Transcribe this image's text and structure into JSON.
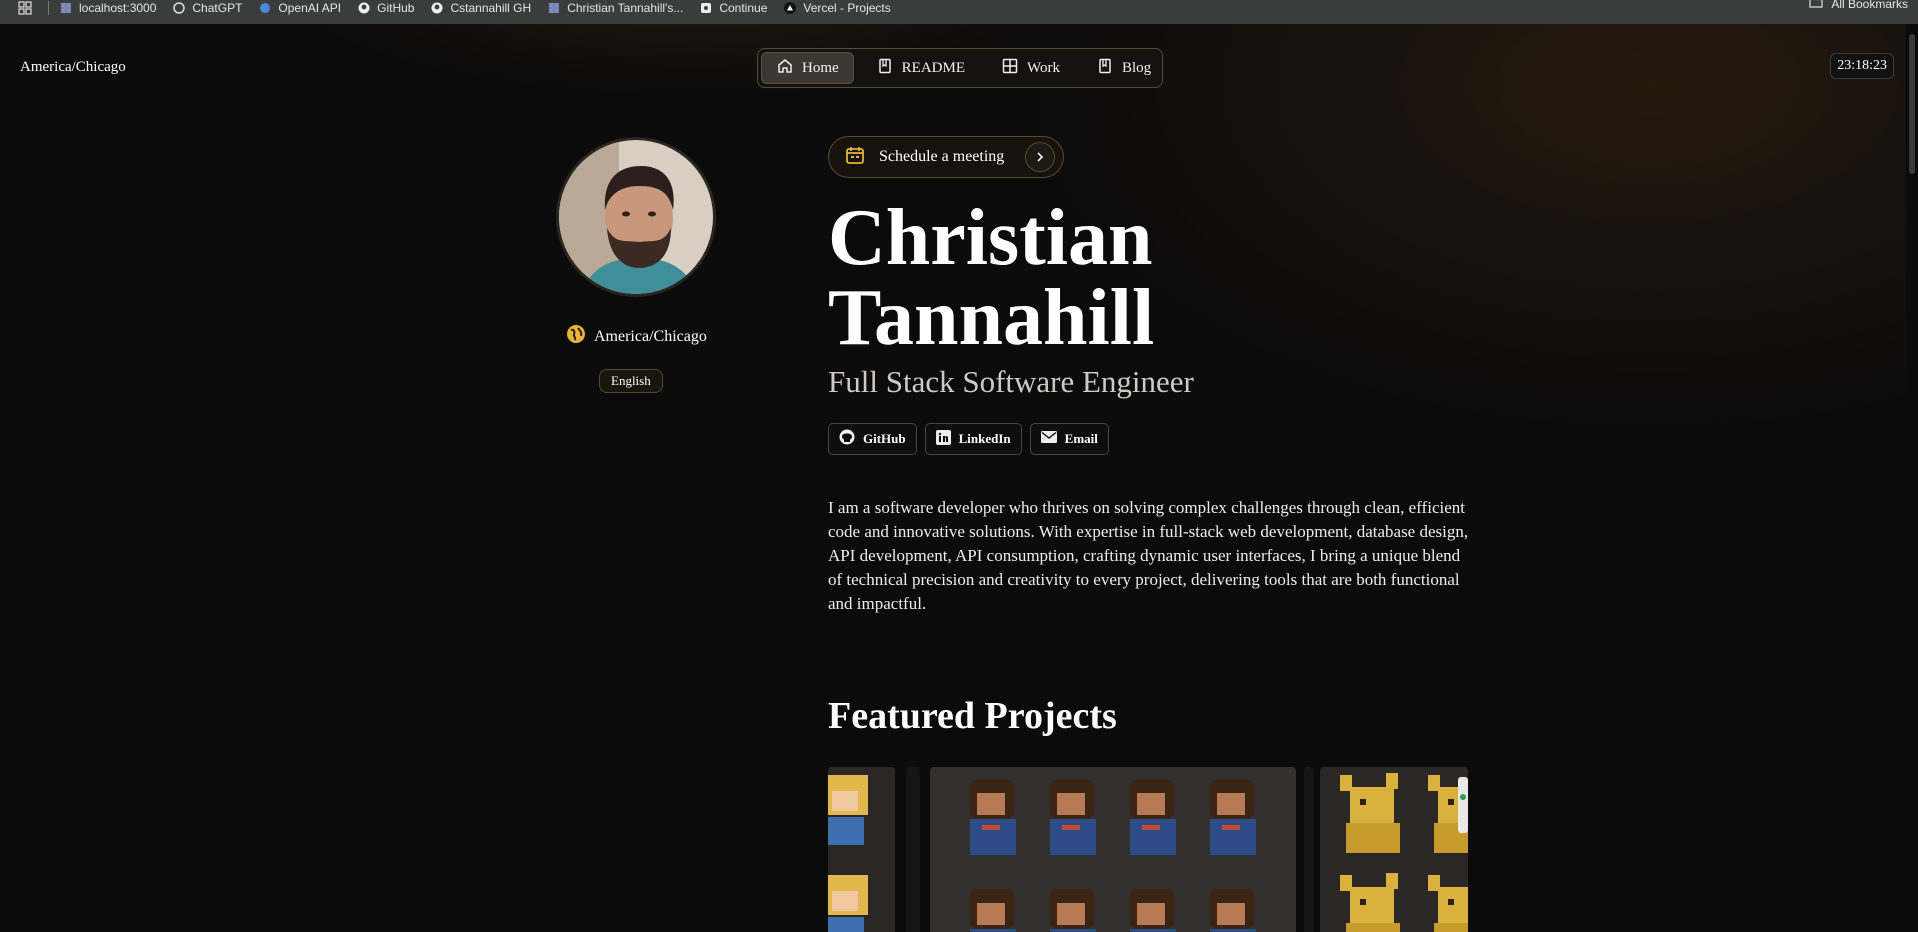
{
  "bookmarks": {
    "items": [
      {
        "label": "localhost:3000",
        "icon": "page-icon"
      },
      {
        "label": "ChatGPT",
        "icon": "openai-icon"
      },
      {
        "label": "OpenAI API",
        "icon": "openai-icon"
      },
      {
        "label": "GitHub",
        "icon": "github-icon"
      },
      {
        "label": "Cstannahill GH",
        "icon": "github-icon"
      },
      {
        "label": "Christian Tannahill's...",
        "icon": "page-icon"
      },
      {
        "label": "Continue",
        "icon": "continue-icon"
      },
      {
        "label": "Vercel - Projects",
        "icon": "vercel-icon"
      }
    ],
    "all_label": "All Bookmarks"
  },
  "header": {
    "timezone": "America/Chicago",
    "clock": "23:18:23",
    "nav": [
      {
        "label": "Home",
        "icon": "home-icon",
        "active": true
      },
      {
        "label": "README",
        "icon": "book-icon"
      },
      {
        "label": "Work",
        "icon": "grid-icon"
      },
      {
        "label": "Blog",
        "icon": "book-icon"
      }
    ]
  },
  "profile": {
    "location": "America/Chicago",
    "language": "English"
  },
  "hero": {
    "schedule_label": "Schedule a meeting",
    "name_line1": "Christian",
    "name_line2": "Tannahill",
    "role": "Full Stack Software Engineer",
    "socials": [
      {
        "label": "GitHub",
        "icon": "github-icon"
      },
      {
        "label": "LinkedIn",
        "icon": "linkedin-icon"
      },
      {
        "label": "Email",
        "icon": "email-icon"
      }
    ],
    "bio": "I am a software developer who thrives on solving complex challenges through clean, efficient code and innovative solutions. With expertise in full-stack web development, database design, API development, API consumption, crafting dynamic user interfaces, I bring a unique blend of technical precision and creativity to every project, delivering tools that are both functional and impactful."
  },
  "featured": {
    "title": "Featured Projects"
  },
  "colors": {
    "accent": "#e8b33c",
    "border": "#5a4a2c",
    "background": "#0b0b0c"
  }
}
